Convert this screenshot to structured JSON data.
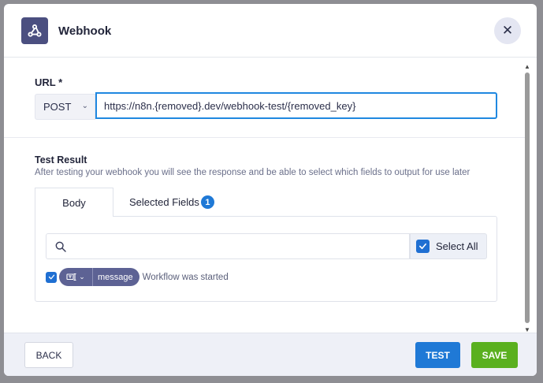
{
  "header": {
    "title": "Webhook",
    "icon": "webhook-icon",
    "close_icon": "close-icon"
  },
  "url": {
    "label": "URL *",
    "method": "POST",
    "value": "https://n8n.{removed}.dev/webhook-test/{removed_key}"
  },
  "test_result": {
    "label": "Test Result",
    "description": "After testing your webhook you will see the response and be able to select which fields to output for use later",
    "tabs": [
      {
        "label": "Body"
      },
      {
        "label": "Selected Fields",
        "badge": "1"
      }
    ],
    "search": {
      "placeholder": ""
    },
    "select_all_label": "Select All",
    "fields": [
      {
        "key": "message",
        "value": "Workflow was started"
      }
    ]
  },
  "footer": {
    "back_label": "BACK",
    "test_label": "TEST",
    "save_label": "SAVE"
  },
  "colors": {
    "primary": "#1f79d6",
    "save": "#5ab01f",
    "pill": "#5d6294",
    "app_icon_bg": "#4b4f80"
  }
}
